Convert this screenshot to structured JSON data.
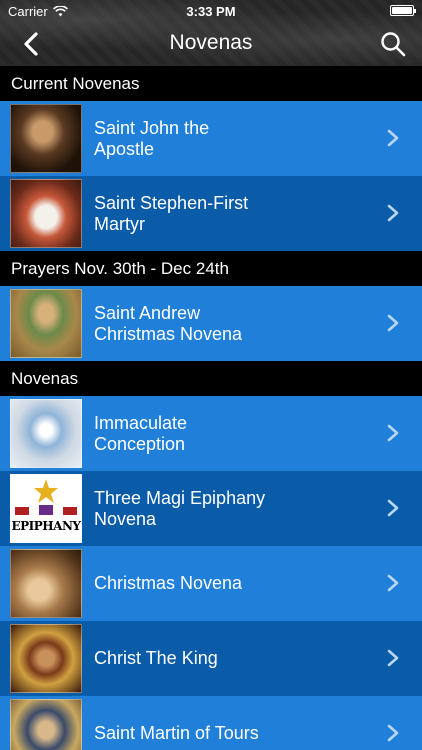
{
  "status": {
    "carrier": "Carrier",
    "time": "3:33 PM",
    "battery_level": 1.0
  },
  "nav": {
    "title": "Novenas",
    "back_icon": "chevron-left-icon",
    "search_icon": "search-icon"
  },
  "sections": [
    {
      "header": "Current Novenas",
      "items": [
        {
          "label": "Saint John the\nApostle"
        },
        {
          "label": "Saint Stephen-First\nMartyr"
        }
      ]
    },
    {
      "header": "Prayers Nov. 30th - Dec 24th",
      "items": [
        {
          "label": "Saint Andrew\nChristmas Novena"
        }
      ]
    },
    {
      "header": "Novenas",
      "items": [
        {
          "label": "Immaculate\nConception"
        },
        {
          "label": "Three Magi Epiphany\nNovena",
          "image_text": "EPIPHANY"
        },
        {
          "label": "Christmas Novena"
        },
        {
          "label": "Christ The King"
        },
        {
          "label": "Saint Martin of Tours"
        }
      ]
    }
  ],
  "colors": {
    "row_light": "#1f7fd9",
    "row_dark": "#0a5ba8",
    "section_bg": "#000000",
    "header_bg": "#262626"
  }
}
